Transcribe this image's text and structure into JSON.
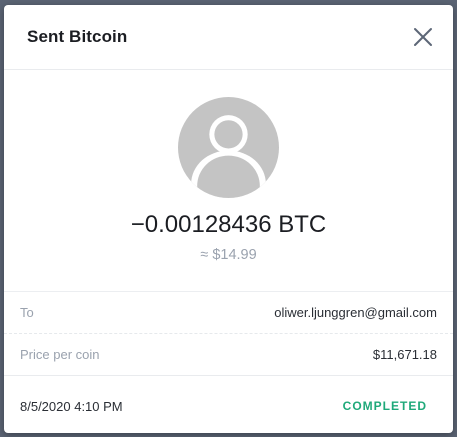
{
  "modal": {
    "title": "Sent Bitcoin",
    "close_icon": "close-icon"
  },
  "avatar": {
    "icon": "user-placeholder-icon",
    "color": "#c4c4c4"
  },
  "transaction": {
    "amount": "−0.00128436 BTC",
    "fiat_value": "≈ $14.99"
  },
  "details": [
    {
      "label": "To",
      "value": "oliwer.ljunggren@gmail.com"
    },
    {
      "label": "Price per coin",
      "value": "$11,671.18"
    }
  ],
  "footer": {
    "date": "8/5/2020 4:10 PM",
    "status": "COMPLETED",
    "status_color": "#1fa97a"
  }
}
